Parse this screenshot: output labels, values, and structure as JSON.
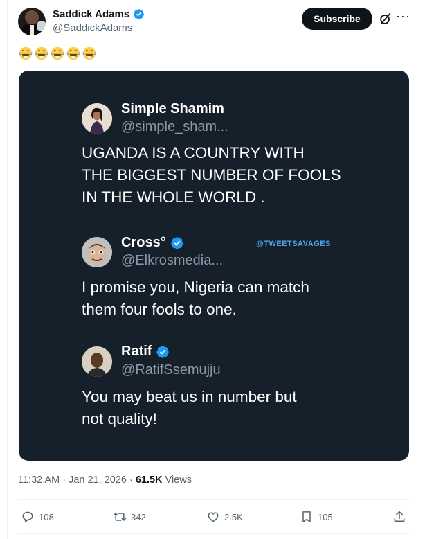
{
  "author": {
    "display_name": "Saddick Adams",
    "handle": "@SaddickAdams",
    "verified": true
  },
  "header": {
    "subscribe_label": "Subscribe",
    "more_label": "···"
  },
  "post": {
    "text": "😂😂😂😂😂",
    "emoji_count": 5
  },
  "media": {
    "watermark": "@TWEETSAVAGES",
    "tweets": [
      {
        "name": "Simple Shamim",
        "handle": "@simple_sham...",
        "verified": false,
        "text": "UGANDA IS A COUNTRY WITH\nTHE BIGGEST NUMBER OF FOOLS\nIN THE WHOLE WORLD ."
      },
      {
        "name": "Cross°",
        "handle": "@Elkrosmedia...",
        "verified": true,
        "text": "I promise you, Nigeria can match\nthem four fools to one."
      },
      {
        "name": "Ratif",
        "handle": "@RatifSsemujju",
        "verified": true,
        "text": "You may beat us in number but\nnot quality!"
      }
    ]
  },
  "meta": {
    "timestamp": "11:32 AM · Jan 21, 2026 · ",
    "views_count": "61.5K",
    "views_label": " Views"
  },
  "actions": {
    "replies": "108",
    "reposts": "342",
    "likes": "2.5K",
    "bookmarks": "105"
  },
  "colors": {
    "verified": "#1d9bf0",
    "media_bg": "#15202b",
    "watermark": "#4fa6ec"
  }
}
